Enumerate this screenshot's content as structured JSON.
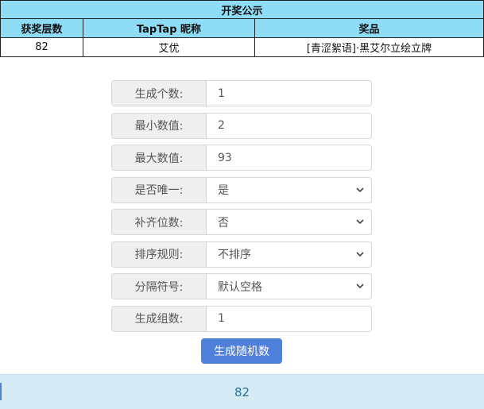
{
  "table": {
    "title": "开奖公示",
    "headers": [
      "获奖层数",
      "TapTap 昵称",
      "奖品"
    ],
    "row": {
      "floor": "82",
      "nickname": "艾优",
      "prize": "[青涩絮语]·黑艾尔立绘立牌"
    }
  },
  "form": {
    "fields": [
      {
        "label": "生成个数:",
        "value": "1",
        "type": "input"
      },
      {
        "label": "最小数值:",
        "value": "2",
        "type": "input"
      },
      {
        "label": "最大数值:",
        "value": "93",
        "type": "input"
      },
      {
        "label": "是否唯一:",
        "value": "是",
        "type": "select"
      },
      {
        "label": "补齐位数:",
        "value": "否",
        "type": "select"
      },
      {
        "label": "排序规则:",
        "value": "不排序",
        "type": "select"
      },
      {
        "label": "分隔符号:",
        "value": "默认空格",
        "type": "select"
      },
      {
        "label": "生成组数:",
        "value": "1",
        "type": "input"
      }
    ],
    "button_label": "生成随机数"
  },
  "result": {
    "value": "82"
  },
  "colors": {
    "header_bg": "#8fdcf7",
    "button_bg": "#4f80dc",
    "result_bg": "#d5ecf6"
  }
}
